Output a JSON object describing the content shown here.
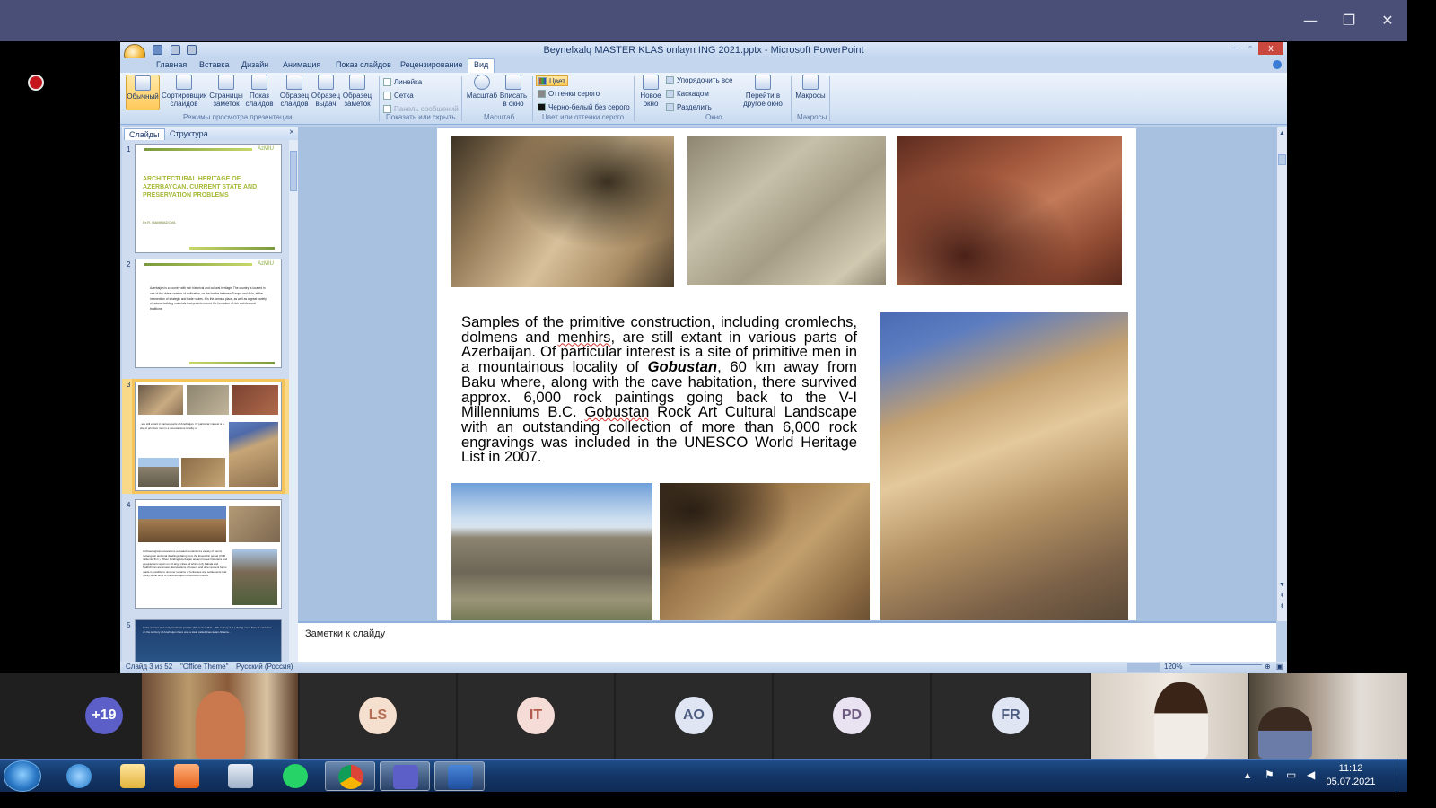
{
  "teams": {
    "window_controls": [
      "—",
      "❐",
      "✕"
    ]
  },
  "ppt": {
    "title": "Beynelxalq MASTER KLAS onlayn ING 2021.pptx - Microsoft PowerPoint",
    "tabs": [
      "Главная",
      "Вставка",
      "Дизайн",
      "Анимация",
      "Показ слайдов",
      "Рецензирование",
      "Вид"
    ],
    "active_tab": "Вид",
    "ribbon": {
      "presentation_views": {
        "buttons": [
          "Обычный",
          "Сортировщик слайдов",
          "Страницы заметок",
          "Показ слайдов",
          "Образец слайдов",
          "Образец выдач",
          "Образец заметок"
        ],
        "label": "Режимы просмотра презентации"
      },
      "show_hide": {
        "items": [
          "Линейка",
          "Сетка",
          "Панель сообщений"
        ],
        "label": "Показать или скрыть"
      },
      "zoom": {
        "buttons": [
          "Масштаб",
          "Вписать в окно"
        ],
        "label": "Масштаб"
      },
      "color": {
        "items": [
          "Цвет",
          "Оттенки серого",
          "Черно-белый без серого"
        ],
        "label": "Цвет или оттенки серого"
      },
      "window": {
        "new_window": "Новое окно",
        "items": [
          "Упорядочить все",
          "Каскадом",
          "Разделить"
        ],
        "switch": "Перейти в другое окно",
        "label": "Окно"
      },
      "macros": {
        "button": "Макросы",
        "label": "Макросы"
      }
    },
    "pane": {
      "tabs": [
        "Слайды",
        "Структура"
      ],
      "close": "×",
      "thumbs": [
        {
          "num": "1",
          "title": "ARCHITECTURAL HERITAGE OF AZERBAYCAN. CURRENT STATE AND PRESERVATION PROBLEMS",
          "author": "Dr.R. MAMMADOVA",
          "logo": "AzMIU"
        },
        {
          "num": "2",
          "logo": "AzMIU",
          "body": "Azerbaijan is a country with rich historical and cultural heritage. The country is located in one of the oldest centers of civilization, on the border between Europe and Asia, at the intersection of strategic and trade routes. It is the famous place, as well as a great variety of natural building materials that predetermined the formation of rich architectural traditions."
        },
        {
          "num": "3"
        },
        {
          "num": "4",
          "body": "Archaeological excavations revealed remains of a variety of round, rectangular and oval dwellings dating from the Eneolithic period (IV-III millennia B.C.). When building Azerbaijan ancient Greek historians and geographers report on 26 large cities, of which only Kabala and Nakhchivan are known. Excavations of towers and other ancient forms made it possible to uncover remains of fortresses and settlements that testify to the level of the Azerbaijan construction culture."
        },
        {
          "num": "5",
          "body": "In the ancient and early medieval periods (4th century B.C. - 7th century A.D.) during more than 11 centuries on the territory of Azerbaijan there was a state called Caucasian Albania..."
        }
      ]
    },
    "slide": {
      "text": {
        "p1": "Samples of the primitive construction, including cromlechs, dolmens and ",
        "menhirs": "menhirs",
        "p2": ", are still extant in various parts of Azerbaijan. Of particular interest is a site of primitive men in a mountainous locality of ",
        "gobustan": "Gobustan",
        "p3": ", 60 km away from Baku where, along with the cave habitation, there survived approx. 6,000 rock paintings going back to the V-I Millenniums B.C. ",
        "gobustan2": "Gobustan",
        "p4": " Rock Art Cultural Landscape with an outstanding collection of more than 6,000 rock engravings was included in the UNESCO World Heritage List in 2007."
      }
    },
    "notes_placeholder": "Заметки к слайду",
    "status": {
      "slide_info": "Слайд 3 из 52",
      "theme": "\"Office Theme\"",
      "language": "Русский (Россия)",
      "zoom": "120%"
    }
  },
  "participants": {
    "overflow": "+19",
    "avatars": [
      {
        "initials": "LS",
        "bg": "#f5dfcf",
        "fg": "#b37055"
      },
      {
        "initials": "IT",
        "bg": "#f5dcd6",
        "fg": "#b4584a"
      },
      {
        "initials": "AO",
        "bg": "#dfe5f2",
        "fg": "#4c5a80"
      },
      {
        "initials": "PD",
        "bg": "#e9e2f0",
        "fg": "#6d5b82"
      },
      {
        "initials": "FR",
        "bg": "#dfe5f2",
        "fg": "#4c5a80"
      }
    ]
  },
  "taskbar": {
    "time": "11:12",
    "date": "05.07.2021",
    "apps": [
      "windows-start",
      "internet-explorer",
      "file-explorer",
      "media-player",
      "calculator",
      "whatsapp",
      "chrome",
      "teams",
      "word"
    ]
  },
  "colors": {
    "teams_bar": "#494f76",
    "ppt_frame": "#bcd0ea",
    "accent_orange": "#ffc95a",
    "title_olive": "#a6b834"
  }
}
